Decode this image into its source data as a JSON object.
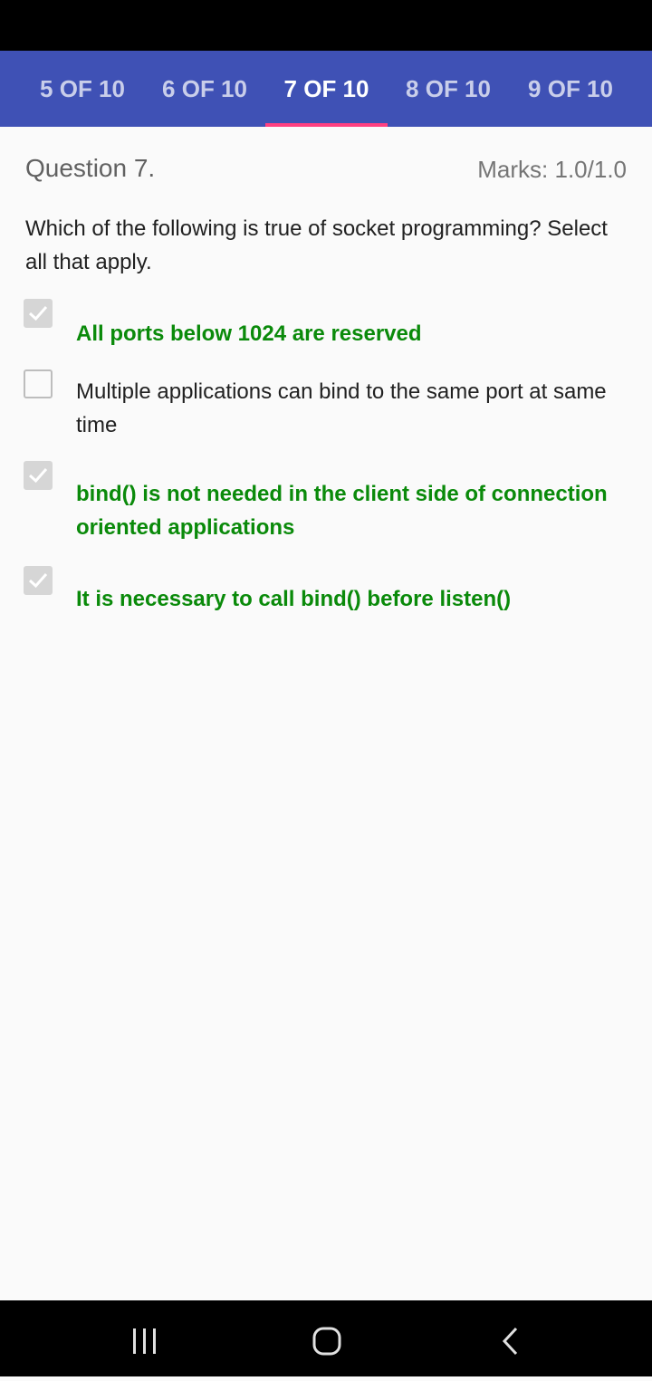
{
  "tabs": [
    {
      "label": "5 OF 10",
      "active": false
    },
    {
      "label": "6 OF 10",
      "active": false
    },
    {
      "label": "7 OF 10",
      "active": true
    },
    {
      "label": "8 OF 10",
      "active": false
    },
    {
      "label": "9 OF 10",
      "active": false
    }
  ],
  "question": {
    "title": "Question 7.",
    "marks": "Marks: 1.0/1.0",
    "text": "Which of the following is true of socket programming? Select all that apply.",
    "options": [
      {
        "label": "All ports below 1024 are reserved",
        "checked": true,
        "correct": true
      },
      {
        "label": "Multiple applications can bind to the same port at same time",
        "checked": false,
        "correct": false
      },
      {
        "label": "bind() is not needed in the client side of connection oriented applications",
        "checked": true,
        "correct": true
      },
      {
        "label": "It is necessary to call bind() before listen()",
        "checked": true,
        "correct": true
      }
    ]
  },
  "colors": {
    "app_bar": "#3f51b5",
    "tab_indicator": "#ff4081",
    "correct_text": "#0a8a0a"
  },
  "icons": {
    "checkbox_checked": "check-icon",
    "nav_recent": "recent-apps-icon",
    "nav_home": "home-icon",
    "nav_back": "back-icon"
  }
}
